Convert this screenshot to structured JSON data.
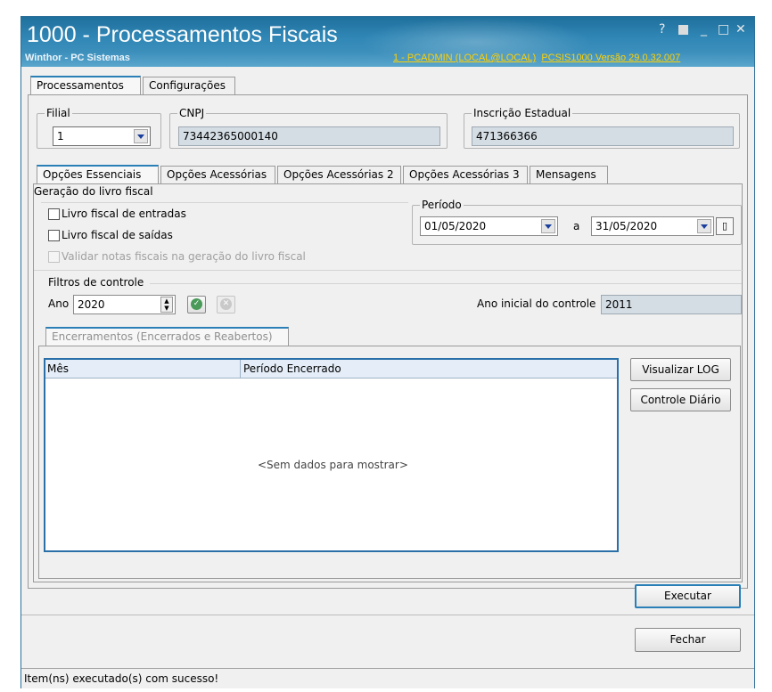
{
  "window": {
    "title": "1000 - Processamentos Fiscais",
    "subtitle": "Winthor - PC Sistemas",
    "user_info": "1 - PCADMIN (LOCAL@LOCAL)",
    "sys_info": "PCSIS1000  Versão  29.0.32.007",
    "controls": {
      "help": "?",
      "minimize": "_",
      "maximize": "□",
      "close": "✕"
    }
  },
  "main_tabs": [
    "Processamentos",
    "Configurações"
  ],
  "filial": {
    "label": "Filial",
    "value": "1"
  },
  "cnpj": {
    "label": "CNPJ",
    "value": "73442365000140"
  },
  "inscricao": {
    "label": "Inscrição Estadual",
    "value": "471366366"
  },
  "sub_tabs": [
    "Opções Essenciais",
    "Opções Acessórias",
    "Opções Acessórias 2",
    "Opções Acessórias 3",
    "Mensagens"
  ],
  "geracao": {
    "label": "Geração do livro fiscal",
    "entradas": "Livro fiscal de entradas",
    "saidas": "Livro fiscal de saídas",
    "validar": "Validar notas fiscais na geração do livro fiscal"
  },
  "periodo": {
    "label": "Período",
    "start": "01/05/2020",
    "sep": "a",
    "end": "31/05/2020"
  },
  "filtros": {
    "label": "Filtros de controle",
    "ano_label": "Ano",
    "ano_value": "2020",
    "ano_inicial_label": "Ano inicial do controle",
    "ano_inicial_value": "2011"
  },
  "encerramentos": {
    "tab": "Encerramentos (Encerrados e Reabertos)",
    "columns": [
      "Mês",
      "Período Encerrado"
    ],
    "empty": "<Sem dados para mostrar>"
  },
  "buttons": {
    "visualizar_log": "Visualizar LOG",
    "controle_diario": "Controle Diário",
    "executar": "Executar",
    "fechar": "Fechar"
  },
  "status": "Item(ns) executado(s) com sucesso!"
}
